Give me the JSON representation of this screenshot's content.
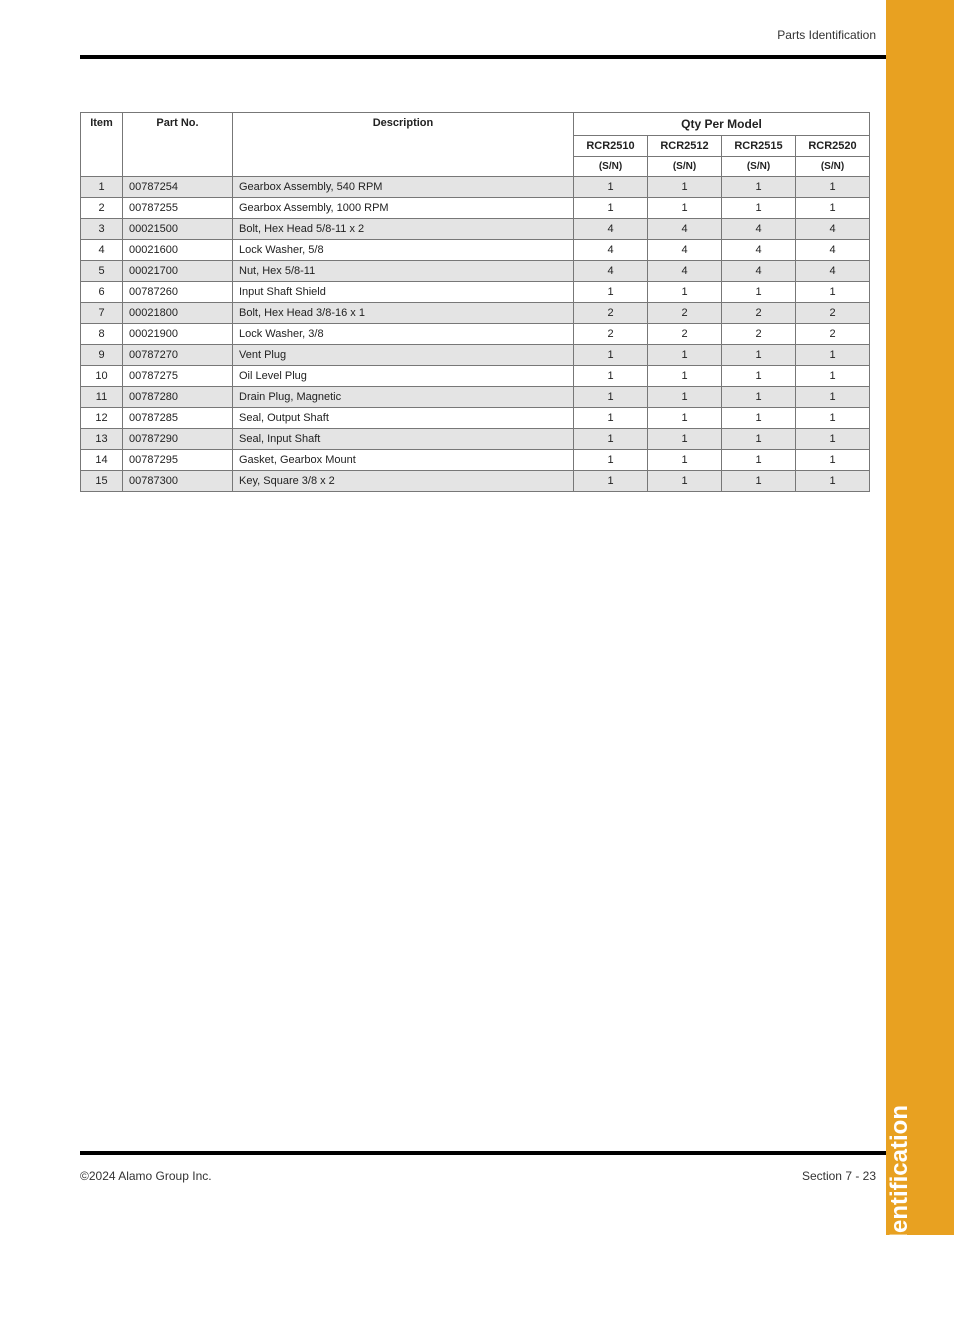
{
  "header": {
    "section_title": "Parts Identification"
  },
  "footer": {
    "left": "©2024 Alamo Group Inc.",
    "right": "Section 7 - 23"
  },
  "side_tab": "Parts Identification",
  "table": {
    "headers": {
      "item": "Item",
      "part_no": "Part No.",
      "description": "Description",
      "qty_group": "Qty Per Model",
      "models": [
        "RCR2510",
        "RCR2512",
        "RCR2515",
        "RCR2520"
      ],
      "serial_prefix": [
        "(S/N)",
        "(S/N)",
        "(S/N)",
        "(S/N)"
      ]
    },
    "rows": [
      {
        "item": "1",
        "part": "00787254",
        "desc": "Gearbox Assembly, 540 RPM",
        "q": [
          "1",
          "1",
          "1",
          "1"
        ]
      },
      {
        "item": "2",
        "part": "00787255",
        "desc": "Gearbox Assembly, 1000 RPM",
        "q": [
          "1",
          "1",
          "1",
          "1"
        ]
      },
      {
        "item": "3",
        "part": "00021500",
        "desc": "Bolt, Hex Head 5/8-11 x 2",
        "q": [
          "4",
          "4",
          "4",
          "4"
        ]
      },
      {
        "item": "4",
        "part": "00021600",
        "desc": "Lock Washer, 5/8",
        "q": [
          "4",
          "4",
          "4",
          "4"
        ]
      },
      {
        "item": "5",
        "part": "00021700",
        "desc": "Nut, Hex 5/8-11",
        "q": [
          "4",
          "4",
          "4",
          "4"
        ]
      },
      {
        "item": "6",
        "part": "00787260",
        "desc": "Input Shaft Shield",
        "q": [
          "1",
          "1",
          "1",
          "1"
        ]
      },
      {
        "item": "7",
        "part": "00021800",
        "desc": "Bolt, Hex Head 3/8-16 x 1",
        "q": [
          "2",
          "2",
          "2",
          "2"
        ]
      },
      {
        "item": "8",
        "part": "00021900",
        "desc": "Lock Washer, 3/8",
        "q": [
          "2",
          "2",
          "2",
          "2"
        ]
      },
      {
        "item": "9",
        "part": "00787270",
        "desc": "Vent Plug",
        "q": [
          "1",
          "1",
          "1",
          "1"
        ]
      },
      {
        "item": "10",
        "part": "00787275",
        "desc": "Oil Level Plug",
        "q": [
          "1",
          "1",
          "1",
          "1"
        ]
      },
      {
        "item": "11",
        "part": "00787280",
        "desc": "Drain Plug, Magnetic",
        "q": [
          "1",
          "1",
          "1",
          "1"
        ]
      },
      {
        "item": "12",
        "part": "00787285",
        "desc": "Seal, Output Shaft",
        "q": [
          "1",
          "1",
          "1",
          "1"
        ]
      },
      {
        "item": "13",
        "part": "00787290",
        "desc": "Seal, Input Shaft",
        "q": [
          "1",
          "1",
          "1",
          "1"
        ]
      },
      {
        "item": "14",
        "part": "00787295",
        "desc": "Gasket, Gearbox Mount",
        "q": [
          "1",
          "1",
          "1",
          "1"
        ]
      },
      {
        "item": "15",
        "part": "00787300",
        "desc": "Key, Square 3/8 x 2",
        "q": [
          "1",
          "1",
          "1",
          "1"
        ]
      }
    ]
  }
}
